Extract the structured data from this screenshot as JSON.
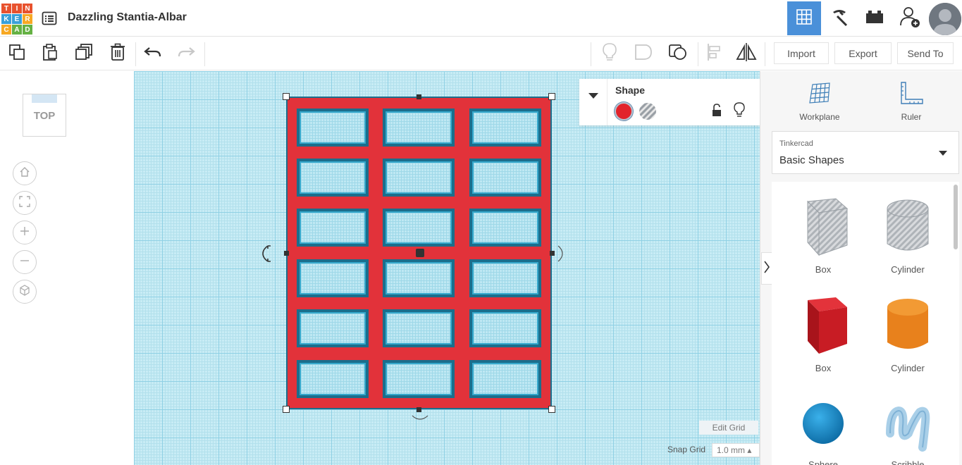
{
  "header": {
    "logo_letters": [
      "T",
      "I",
      "N",
      "K",
      "E",
      "R",
      "C",
      "A",
      "D"
    ],
    "logo_colors": [
      "#e8522e",
      "#e8522e",
      "#e8522e",
      "#3aa0d8",
      "#3aa0d8",
      "#f7a823",
      "#f7a823",
      "#65b144",
      "#65b144"
    ],
    "project_title": "Dazzling Stantia-Albar",
    "views": [
      "grid-view-icon",
      "pickaxe-icon",
      "bricks-icon",
      "add-user-icon"
    ],
    "active_view": "grid-view-icon"
  },
  "toolbar": {
    "import_label": "Import",
    "export_label": "Export",
    "send_to_label": "Send To"
  },
  "viewcube": {
    "label": "TOP"
  },
  "inspector": {
    "title": "Shape",
    "solid_color": "#e2232b"
  },
  "grid": {
    "edit_label": "Edit Grid",
    "snap_label": "Snap Grid",
    "snap_value": "1.0 mm ▴"
  },
  "right_panel": {
    "workplane_label": "Workplane",
    "ruler_label": "Ruler",
    "library_small": "Tinkercad",
    "library_big": "Basic Shapes",
    "shapes": [
      {
        "label": "Box",
        "style": "hole"
      },
      {
        "label": "Cylinder",
        "style": "hole"
      },
      {
        "label": "Box",
        "style": "solid",
        "color": "#d3232b"
      },
      {
        "label": "Cylinder",
        "style": "solid",
        "color": "#e8811c"
      },
      {
        "label": "Sphere",
        "style": "solid",
        "color": "#1a8fd1"
      },
      {
        "label": "Scribble",
        "style": "solid",
        "color": "#a9cfe8"
      }
    ]
  },
  "colors": {
    "accent": "#4a90d9",
    "shape_red": "#e2323a",
    "hole_blue": "#1b6e8c"
  }
}
